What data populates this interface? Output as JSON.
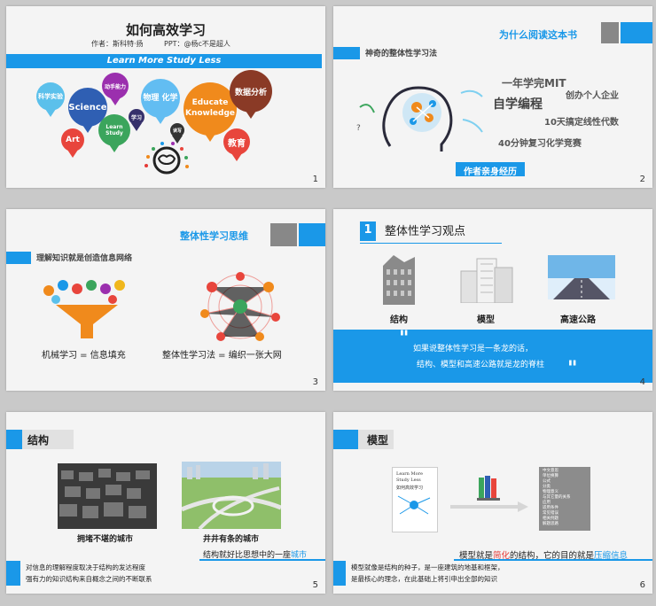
{
  "slides": [
    {
      "number": "1",
      "title": "如何高效学习",
      "author": "作者：斯科特·扬",
      "ppt": "PPT：@杨c不是超人",
      "banner": "Learn More  Study Less",
      "bubbles": [
        "科学实验",
        "Science",
        "动手能力",
        "Learn Study",
        "学习",
        "物理 化学",
        "读写",
        "Educate Knowledge",
        "数据分析",
        "教育",
        "Art"
      ]
    },
    {
      "number": "2",
      "title": "为什么阅读这本书",
      "subtitle": "神奇的整体性学习法",
      "phrases": [
        "一年学完MIT",
        "创办个人企业",
        "自学编程",
        "10天搞定线性代数",
        "40分钟复习化学竞赛"
      ],
      "footer": "作者亲身经历"
    },
    {
      "number": "3",
      "title": "整体性学习思维",
      "subtitle": "理解知识就是创造信息网络",
      "left_caption": "机械学习 = 信息填充",
      "right_caption": "整体性学习法 = 编织一张大网"
    },
    {
      "number": "4",
      "index": "1",
      "title": "整体性学习观点",
      "items": [
        "结构",
        "模型",
        "高速公路"
      ],
      "quote_line1": "如果说整体性学习是一条龙的话，",
      "quote_line2": "结构、模型和高速公路就是龙的脊柱"
    },
    {
      "number": "5",
      "title": "结构",
      "left_caption": "拥堵不堪的城市",
      "right_caption": "井井有条的城市",
      "note_prefix": "结构就好比思想中的一座",
      "note_highlight": "城市",
      "body_line1": "对信息的理解程度取决于结构的发达程度",
      "body_line2": "强有力的知识结构来自概念之间的不断联系"
    },
    {
      "number": "6",
      "title": "模型",
      "book_title": "Learn More Study Less",
      "book_cn": "如何高效学习",
      "list_items": [
        "中文意思",
        "单位换算",
        "公式",
        "分类",
        "物理意义",
        "与其它量的关系",
        "应用",
        "适用条件",
        "常见错误",
        "相关例题",
        "解题思路"
      ],
      "caption_a": "模型就是",
      "caption_b": "简化",
      "caption_c": "的结构，它的目的就是",
      "caption_d": "压缩信息",
      "body_line1": "模型就像是结构的种子，是一座建筑的地基和框架，",
      "body_line2": "是最核心的理念，在此基础上将引申出全部的知识"
    }
  ],
  "colors": {
    "accent": "#1a98e8",
    "grey": "#8c8c8c",
    "dark": "#222222",
    "highlight_red": "#e53935"
  }
}
